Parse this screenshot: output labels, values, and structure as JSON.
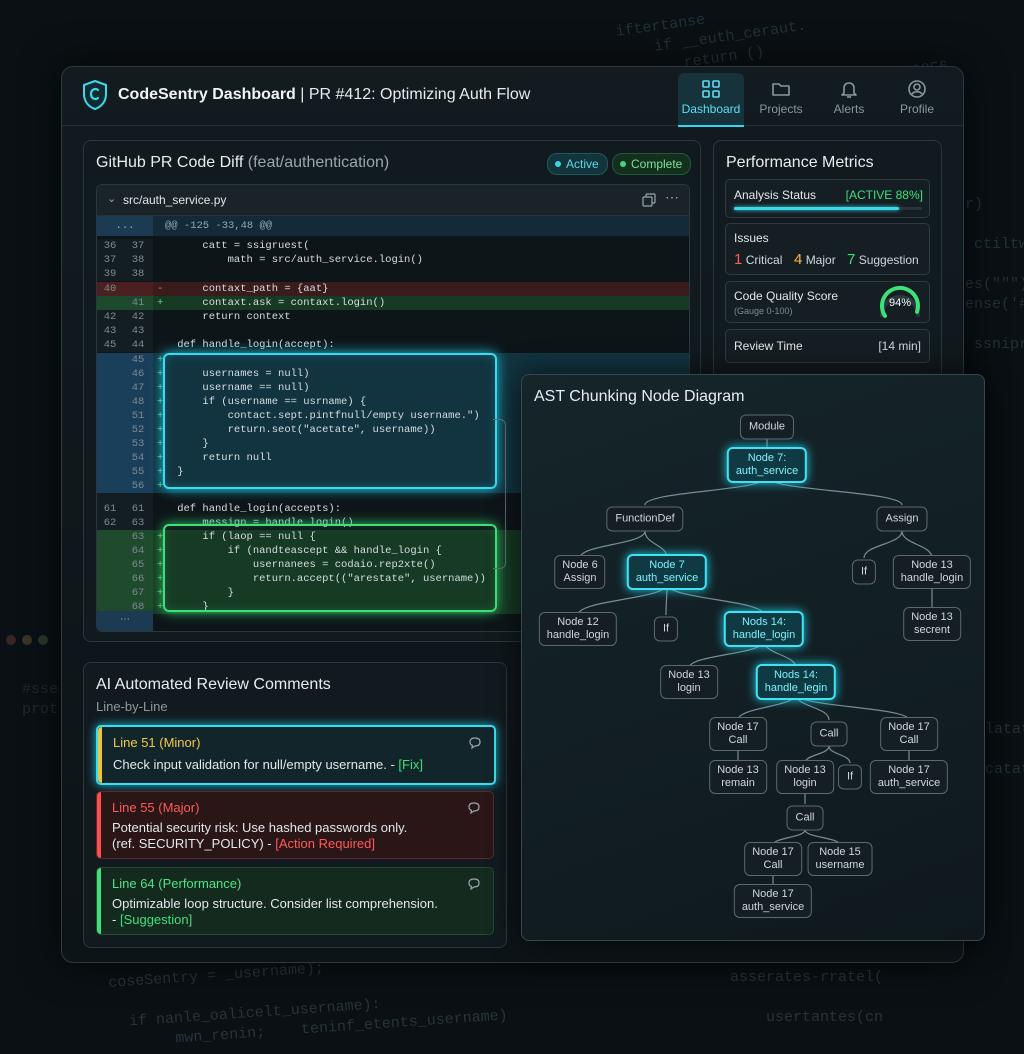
{
  "header": {
    "app_name": "CodeSentry Dashboard",
    "separator": " | ",
    "pr_title": "PR #412: Optimizing Auth Flow",
    "nav": [
      {
        "label": "Dashboard",
        "icon": "dashboard-icon",
        "active": true
      },
      {
        "label": "Projects",
        "icon": "folder-icon",
        "active": false
      },
      {
        "label": "Alerts",
        "icon": "bell-icon",
        "active": false
      },
      {
        "label": "Profile",
        "icon": "user-icon",
        "active": false
      }
    ]
  },
  "diff_panel": {
    "title": "GitHub PR Code Diff",
    "branch": "(feat/authentication)",
    "status_active": "Active",
    "status_complete": "Complete",
    "file_name": "src/auth_service.py",
    "hunk_header": "@@ -125 -33,48 @@",
    "expand_label": "...",
    "lines": [
      {
        "old": "36",
        "new": "37",
        "sign": "",
        "text": "        catt = ssigruest(",
        "type": "ctx"
      },
      {
        "old": "37",
        "new": "38",
        "sign": "",
        "text": "            math = src/auth_service.login()",
        "type": "ctx"
      },
      {
        "old": "39",
        "new": "38",
        "sign": "",
        "text": "",
        "type": "ctx"
      },
      {
        "old": "40",
        "new": "",
        "sign": "-",
        "text": "        contaxt_path = {aat}",
        "type": "del"
      },
      {
        "old": "",
        "new": "41",
        "sign": "+",
        "text": "        contaxt.ask = contaxt.login()",
        "type": "add"
      },
      {
        "old": "42",
        "new": "42",
        "sign": "",
        "text": "        return context",
        "type": "ctx"
      },
      {
        "old": "43",
        "new": "43",
        "sign": "",
        "text": "",
        "type": "ctx"
      },
      {
        "old": "45",
        "new": "44",
        "sign": "",
        "text": "    def handle_login(accept):",
        "type": "ctx"
      },
      {
        "old": "",
        "new": "45",
        "sign": "+",
        "text": "",
        "type": "addc"
      },
      {
        "old": "",
        "new": "46",
        "sign": "+",
        "text": "        usernames = null)",
        "type": "addc"
      },
      {
        "old": "",
        "new": "47",
        "sign": "+",
        "text": "        username == null)",
        "type": "addc"
      },
      {
        "old": "",
        "new": "48",
        "sign": "+",
        "text": "        if (username == usrname) {",
        "type": "addc"
      },
      {
        "old": "",
        "new": "51",
        "sign": "+",
        "text": "            contact.sept.pintfnull/empty username.\")",
        "type": "addc"
      },
      {
        "old": "",
        "new": "52",
        "sign": "+",
        "text": "            return.seot(\"acetate\", username))",
        "type": "addc"
      },
      {
        "old": "",
        "new": "53",
        "sign": "+",
        "text": "        }",
        "type": "addc"
      },
      {
        "old": "",
        "new": "54",
        "sign": "+",
        "text": "        return null",
        "type": "addc"
      },
      {
        "old": "",
        "new": "55",
        "sign": "+",
        "text": "    }",
        "type": "addc"
      },
      {
        "old": "",
        "new": "56",
        "sign": "+",
        "text": "",
        "type": "addc"
      },
      {
        "old": "",
        "new": "",
        "sign": "",
        "text": "",
        "type": "ctx"
      },
      {
        "old": "61",
        "new": "61",
        "sign": "",
        "text": "    def handle_login(accepts):",
        "type": "ctx"
      },
      {
        "old": "62",
        "new": "63",
        "sign": "",
        "text": "        messign = handle_login()",
        "type": "ctx"
      },
      {
        "old": "",
        "new": "63",
        "sign": "+",
        "text": "        if (laop == null {",
        "type": "addg"
      },
      {
        "old": "",
        "new": "64",
        "sign": "+",
        "text": "            if (nandteascept && handle_login {",
        "type": "addg"
      },
      {
        "old": "",
        "new": "65",
        "sign": "+",
        "text": "                usernanees = codaio.rep2xte()",
        "type": "addg"
      },
      {
        "old": "",
        "new": "66",
        "sign": "+",
        "text": "                return.accept((\"arestate\", username))",
        "type": "addg"
      },
      {
        "old": "",
        "new": "67",
        "sign": "+",
        "text": "            }",
        "type": "addg"
      },
      {
        "old": "",
        "new": "68",
        "sign": "+",
        "text": "        }",
        "type": "addg"
      }
    ]
  },
  "metrics": {
    "title": "Performance Metrics",
    "analysis_label": "Analysis Status",
    "analysis_value": "[ACTIVE 88%]",
    "analysis_progress": 0.88,
    "issues_label": "Issues",
    "critical_count": "1",
    "critical_label": "Critical",
    "major_count": "4",
    "major_label": "Major",
    "suggestion_count": "7",
    "suggestion_label": "Suggestion",
    "quality_label": "Code Quality Score",
    "quality_sub": "(Gauge 0-100)",
    "quality_value": "94%",
    "quality_score": 94,
    "review_label": "Review Time",
    "review_value": "[14 min]"
  },
  "comments": {
    "title": "AI Automated Review Comments",
    "subtitle": "Line-by-Line",
    "items": [
      {
        "heading": "Line 51 (Minor)",
        "body1": "Check input validation for null/empty username. - ",
        "tag": "[Fix]",
        "body2": ""
      },
      {
        "heading": "Line 55 (Major)",
        "body1": "Potential security risk: Use hashed passwords only.",
        "body2": "(ref. SECURITY_POLICY) - ",
        "tag": "[Action Required]"
      },
      {
        "heading": "Line 64 (Performance)",
        "body1": "Optimizable loop structure. Consider list comprehension.",
        "body2": "- ",
        "tag": "[Suggestion]"
      }
    ]
  },
  "ast": {
    "title": "AST Chunking Node Diagram",
    "nodes": [
      {
        "id": "module",
        "l1": "Module",
        "l2": ""
      },
      {
        "id": "n7a",
        "l1": "Node 7:",
        "l2": "auth_service",
        "hl": true
      },
      {
        "id": "fdef",
        "l1": "FunctionDef",
        "l2": ""
      },
      {
        "id": "assign",
        "l1": "Assign",
        "l2": ""
      },
      {
        "id": "n6",
        "l1": "Node 6",
        "l2": "Assign"
      },
      {
        "id": "n7b",
        "l1": "Node 7",
        "l2": "auth_service",
        "hl": true
      },
      {
        "id": "if1",
        "l1": "If",
        "l2": ""
      },
      {
        "id": "n13a",
        "l1": "Node 13",
        "l2": "handle_login"
      },
      {
        "id": "n12",
        "l1": "Node 12",
        "l2": "handle_login"
      },
      {
        "id": "if2",
        "l1": "If",
        "l2": ""
      },
      {
        "id": "n14a",
        "l1": "Nods 14:",
        "l2": "handle_login",
        "hl": true
      },
      {
        "id": "n13s",
        "l1": "Node 13",
        "l2": "secrent"
      },
      {
        "id": "n13l",
        "l1": "Node 13",
        "l2": "login"
      },
      {
        "id": "n14b",
        "l1": "Nods 14:",
        "l2": "handle_legin",
        "hl": true
      },
      {
        "id": "n17c1",
        "l1": "Node 17",
        "l2": "Call"
      },
      {
        "id": "call1",
        "l1": "Call",
        "l2": ""
      },
      {
        "id": "n17c2",
        "l1": "Node 17",
        "l2": "Call"
      },
      {
        "id": "n13r",
        "l1": "Node 13",
        "l2": "remain"
      },
      {
        "id": "n13l2",
        "l1": "Node 13",
        "l2": "login"
      },
      {
        "id": "if3",
        "l1": "If",
        "l2": ""
      },
      {
        "id": "n17as",
        "l1": "Node 17",
        "l2": "auth_service"
      },
      {
        "id": "call2",
        "l1": "Call",
        "l2": ""
      },
      {
        "id": "n17c3",
        "l1": "Node 17",
        "l2": "Call"
      },
      {
        "id": "n15",
        "l1": "Node 15",
        "l2": "username"
      },
      {
        "id": "n17as2",
        "l1": "Node 17",
        "l2": "auth_service"
      }
    ]
  },
  "background": {
    "top_right": "iftertanse\n    if __euth_ceraut.\n       return ()\n\n         meta.antoring_login, '#02E6",
    "right": "r)\n\n ctiltw\n\nes(\"\"\")\nense('#\n\n ssnipr",
    "left": "#sse\nprot",
    "bottom": "coseSentry = _username);\n\n  if nanle_oalicelt_username):\n       mwn_renin;    teninf_etents_username)",
    "bottom_right": "asserates-rratel(\n\n    usertantes(cn",
    "far_right_bottom": "latata\n\ncatata"
  }
}
